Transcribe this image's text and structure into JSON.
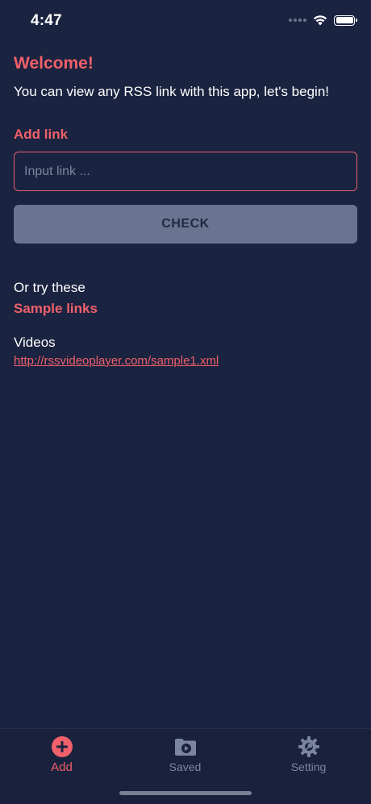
{
  "status_bar": {
    "time": "4:47"
  },
  "main": {
    "welcome_title": "Welcome!",
    "welcome_text": "You can view any RSS link with this app, let's begin!",
    "add_link_label": "Add link",
    "input_placeholder": "Input link ...",
    "input_value": "",
    "check_label": "CHECK",
    "or_try_text": "Or try these",
    "sample_links_title": "Sample links",
    "samples": [
      {
        "category": "Videos",
        "url": "http://rssvideoplayer.com/sample1.xml"
      }
    ]
  },
  "tab_bar": {
    "tabs": [
      {
        "label": "Add",
        "icon": "plus-circle-icon",
        "active": true
      },
      {
        "label": "Saved",
        "icon": "video-folder-icon",
        "active": false
      },
      {
        "label": "Setting",
        "icon": "gear-icon",
        "active": false
      }
    ]
  },
  "colors": {
    "background": "#1a2340",
    "accent": "#f0606a",
    "button": "#6a7490",
    "inactive": "#7c85a0"
  }
}
